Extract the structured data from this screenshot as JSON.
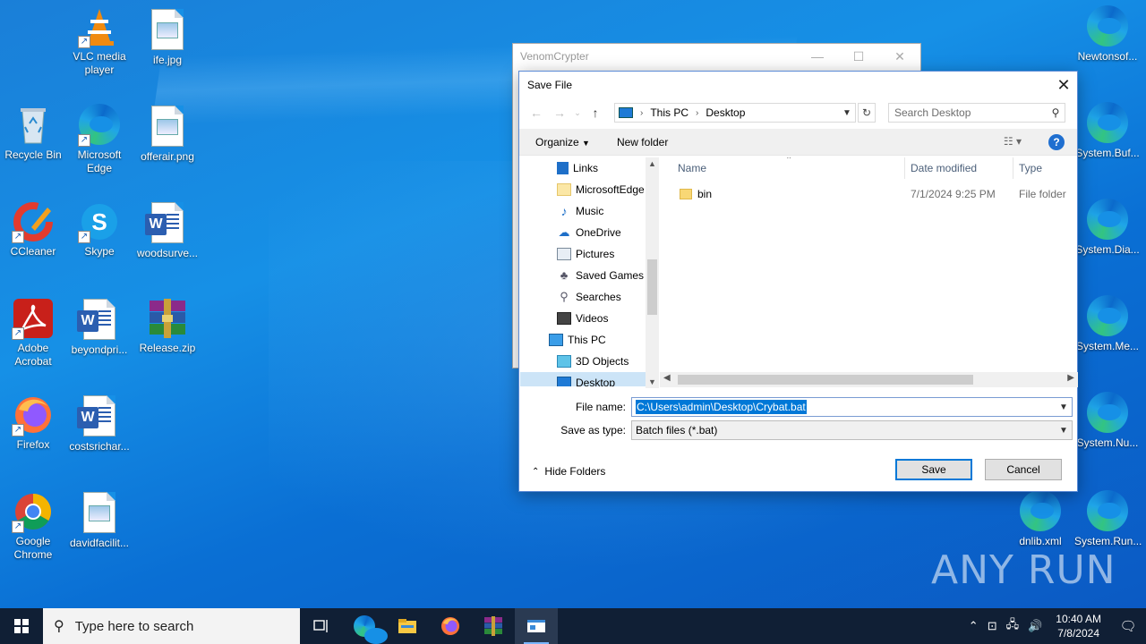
{
  "desktop": {
    "icons": [
      {
        "label": "VLC media player"
      },
      {
        "label": "ife.jpg"
      },
      {
        "label": "Recycle Bin"
      },
      {
        "label": "Microsoft Edge"
      },
      {
        "label": "offerair.png"
      },
      {
        "label": "CCleaner"
      },
      {
        "label": "Skype"
      },
      {
        "label": "woodsurve..."
      },
      {
        "label": "Adobe Acrobat"
      },
      {
        "label": "beyondpri..."
      },
      {
        "label": "Release.zip"
      },
      {
        "label": "Firefox"
      },
      {
        "label": "costsrichar..."
      },
      {
        "label": "Google Chrome"
      },
      {
        "label": "davidfacilit..."
      },
      {
        "label": "Newtonsof..."
      },
      {
        "label": "System.Buf..."
      },
      {
        "label": "System.Dia..."
      },
      {
        "label": "System.Me..."
      },
      {
        "label": "System.Nu..."
      },
      {
        "label": "dnlib.xml"
      },
      {
        "label": "System.Run..."
      }
    ],
    "watermark": "ANY RUN"
  },
  "venom_window": {
    "title": "VenomCrypter"
  },
  "dialog": {
    "title": "Save File",
    "address": {
      "segment1": "This PC",
      "segment2": "Desktop"
    },
    "search_placeholder": "Search Desktop",
    "toolbar": {
      "organize": "Organize",
      "new_folder": "New folder"
    },
    "tree": [
      {
        "label": "Links"
      },
      {
        "label": "MicrosoftEdge"
      },
      {
        "label": "Music"
      },
      {
        "label": "OneDrive"
      },
      {
        "label": "Pictures"
      },
      {
        "label": "Saved Games"
      },
      {
        "label": "Searches"
      },
      {
        "label": "Videos"
      },
      {
        "label": "This PC"
      },
      {
        "label": "3D Objects"
      },
      {
        "label": "Desktop"
      }
    ],
    "columns": {
      "name": "Name",
      "date": "Date modified",
      "type": "Type"
    },
    "rows": [
      {
        "name": "bin",
        "date": "7/1/2024 9:25 PM",
        "type": "File folder"
      }
    ],
    "file_name_label": "File name:",
    "file_name_value": "C:\\Users\\admin\\Desktop\\Crybat.bat",
    "save_type_label": "Save as type:",
    "save_type_value": "Batch files (*.bat)",
    "hide_folders": "Hide Folders",
    "save_button": "Save",
    "cancel_button": "Cancel"
  },
  "taskbar": {
    "search_placeholder": "Type here to search",
    "time": "10:40 AM",
    "date": "7/8/2024"
  }
}
